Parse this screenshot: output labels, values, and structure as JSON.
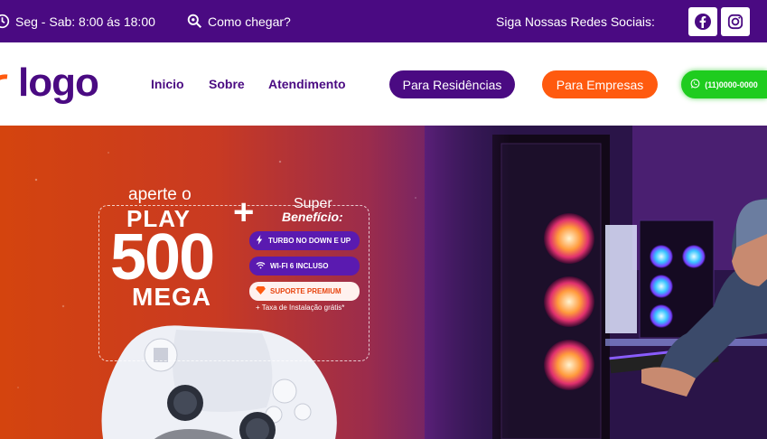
{
  "topbar": {
    "hours": "Seg - Sab: 8:00 ás 18:00",
    "directions": "Como chegar?",
    "social_label": "Siga Nossas Redes Sociais:",
    "bg_color": "#4a0a82"
  },
  "header": {
    "logo": "logo",
    "nav": [
      "Inicio",
      "Sobre",
      "Atendimento"
    ],
    "btn_residencias": "Para Residências",
    "btn_empresas": "Para Empresas",
    "btn_whatsapp": "(11)0000-0000",
    "colors": {
      "purple": "#4a0a82",
      "orange": "#ff5a0f",
      "green": "#1fcc1f"
    }
  },
  "hero": {
    "aperte": "aperte o",
    "play": "PLAY",
    "speed": "500",
    "unit": "MEGA",
    "super": "Super",
    "beneficio": "Benefício:",
    "benefits": [
      "TURBO NO DOWN E UP",
      "WI-FI 6 INCLUSO",
      "SUPORTE PREMIUM"
    ],
    "taxa": "+ Taxa de Instalação grátis*"
  },
  "icons": {
    "clock": "clock-icon",
    "search": "search-location-icon",
    "facebook": "facebook-icon",
    "instagram": "instagram-icon",
    "whatsapp": "whatsapp-icon",
    "bolt": "bolt-icon",
    "wifi": "wifi-icon",
    "diamond": "diamond-icon"
  }
}
